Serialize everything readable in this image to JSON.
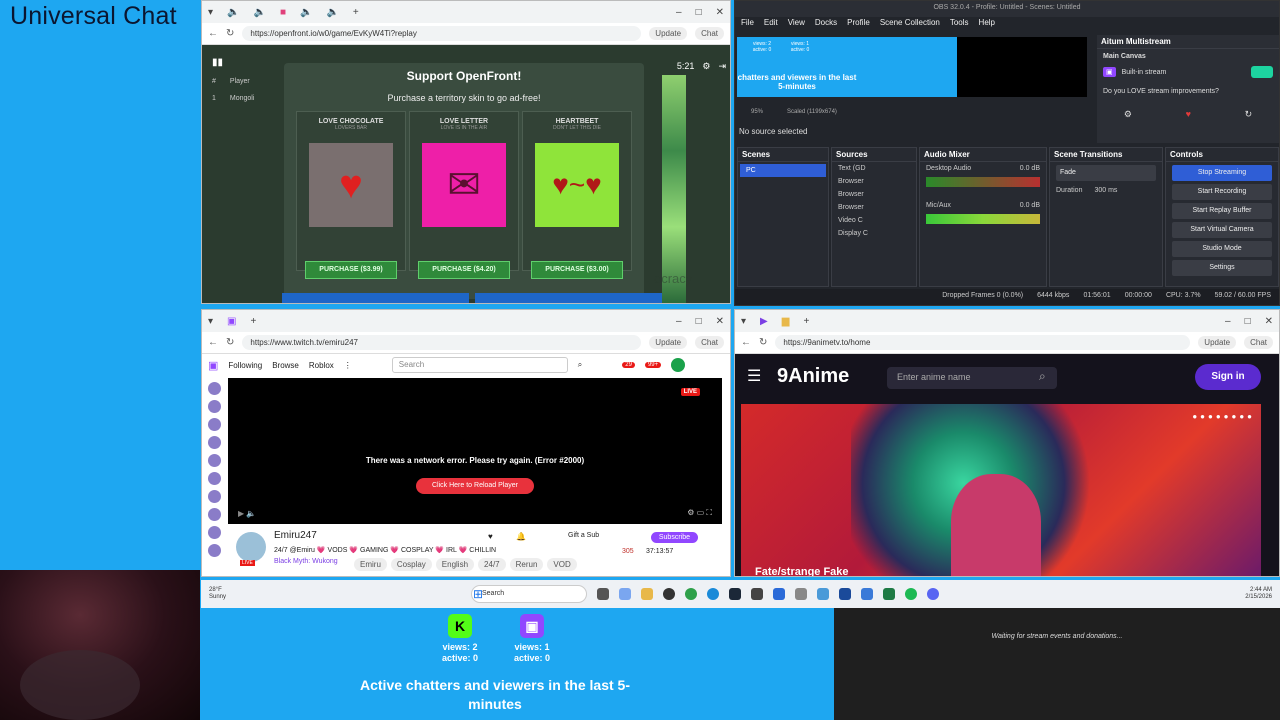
{
  "left_title": "Universal Chat",
  "openfront": {
    "url": "https://openfront.io/w0/game/EvKyW4Ti?replay",
    "update_label": "Update",
    "chat_label": "Chat",
    "leaderboard_head": [
      "#",
      "Player"
    ],
    "leaderboard_row": [
      "1",
      "Mongoli"
    ],
    "modal_title": "Support OpenFront!",
    "modal_subtitle": "Purchase a territory skin to go ad-free!",
    "timer": "5:21",
    "skins": [
      {
        "name": "LOVE CHOCOLATE",
        "sub": "LOVERS BAR",
        "buy": "PURCHASE ($3.99)"
      },
      {
        "name": "LOVE LETTER",
        "sub": "LOVE IS IN THE AIR",
        "buy": "PURCHASE ($4.20)"
      },
      {
        "name": "HEARTBEET",
        "sub": "DON'T LET THIS DIE",
        "buy": "PURCHASE ($3.00)"
      }
    ],
    "bg_word": "ocracy"
  },
  "obs": {
    "title": "OBS 32.0.4 - Profile: Untitled - Scenes: Untitled",
    "menu": [
      "File",
      "Edit",
      "View",
      "Docks",
      "Profile",
      "Scene Collection",
      "Tools",
      "Help"
    ],
    "preview_badges": [
      "views: 2 active: 0",
      "views: 1 active: 0"
    ],
    "preview_text": "chatters and viewers in the last 5-minutes",
    "zoom": "95%",
    "scaled": "Scaled (1199x674)",
    "no_source": "No source selected",
    "aitum_title": "Aitum Multistream",
    "main_canvas": "Main Canvas",
    "builtin_stream": "Built-in stream",
    "love_stream": "Do you LOVE stream improvements?",
    "scenes_title": "Scenes",
    "scene_item": "PC",
    "sources_title": "Sources",
    "sources": [
      "Text (GD",
      "Browser",
      "Browser",
      "Browser",
      "Video C",
      "Display C"
    ],
    "mixer_title": "Audio Mixer",
    "desktop_audio": "Desktop Audio",
    "desktop_db": "0.0 dB",
    "mic_aux": "Mic/Aux",
    "mic_db": "0.0 dB",
    "transitions_title": "Scene Transitions",
    "transition": "Fade",
    "duration_label": "Duration",
    "duration": "300 ms",
    "controls_title": "Controls",
    "controls": [
      "Stop Streaming",
      "Start Recording",
      "Start Replay Buffer",
      "Start Virtual Camera",
      "Studio Mode",
      "Settings"
    ],
    "status": [
      "Dropped Frames 0 (0.0%)",
      "6444 kbps",
      "01:56:01",
      "00:00:00",
      "CPU: 3.7%",
      "59.02 / 60.00 FPS"
    ]
  },
  "twitch": {
    "url": "https://www.twitch.tv/emiru247",
    "update_label": "Update",
    "chat_label": "Chat",
    "nav": [
      "Following",
      "Browse",
      "Roblox"
    ],
    "search_placeholder": "Search",
    "notif_count": "29",
    "whisper_count": "99+",
    "live": "LIVE",
    "error": "There was a network error. Please try again. (Error #2000)",
    "reload": "Click Here to Reload Player",
    "channel": "Emiru247",
    "stream_title": "24/7 @Emiru 💗 VODS 💗 GAMING 💗 COSPLAY 💗 IRL 💗 CHILLIN",
    "game": "Black Myth: Wukong",
    "tags": [
      "Emiru",
      "Cosplay",
      "English",
      "24/7",
      "Rerun",
      "VOD"
    ],
    "gift": "Gift a Sub",
    "subscribe": "Subscribe",
    "viewers": "305",
    "uptime": "37:13:57",
    "avatar_live": "LIVE"
  },
  "anime": {
    "url": "https://9animetv.to/home",
    "update_label": "Update",
    "chat_label": "Chat",
    "logo": "9Anime",
    "search_placeholder": "Enter anime name",
    "signin": "Sign in",
    "hero_title": "Fate/strange Fake"
  },
  "taskbar": {
    "temp": "28°F",
    "weather": "Sunny",
    "search": "Search",
    "time": "2:44 AM",
    "date": "2/15/2026"
  },
  "bottom": {
    "kick": {
      "views": "views: 2",
      "active": "active: 0"
    },
    "twitch": {
      "views": "views: 1",
      "active": "active: 0"
    },
    "chatters_text": "Active chatters and viewers in the last 5-minutes",
    "events_text": "Waiting for stream events and donations..."
  },
  "colors": {
    "background": "#1ea7f1",
    "kick_green": "#53fc18",
    "twitch_purple": "#9147ff"
  }
}
